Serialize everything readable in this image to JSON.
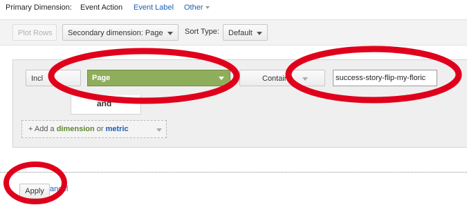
{
  "dimension_bar": {
    "label": "Primary Dimension:",
    "active": "Event Action",
    "link": "Event Label",
    "other": "Other"
  },
  "toolbar": {
    "plot_rows": "Plot Rows",
    "secondary_dimension": "Secondary dimension: Page",
    "sort_type_label": "Sort Type:",
    "sort_type_value": "Default"
  },
  "filter": {
    "include_label": "Incl",
    "dimension_value": "Page",
    "match_type": "Contai",
    "match_type_tail": "ng",
    "expression": "success-story-flip-my-floric",
    "connector": "and",
    "add_prefix": "+ Add a ",
    "add_dimension": "dimension",
    "add_or": " or ",
    "add_metric": "metric"
  },
  "actions": {
    "apply": "Apply",
    "cancel": "ancel"
  },
  "colors": {
    "annotation_red": "#e0001b",
    "dimension_green": "#8fae5c",
    "link_blue": "#1a5fb4"
  }
}
